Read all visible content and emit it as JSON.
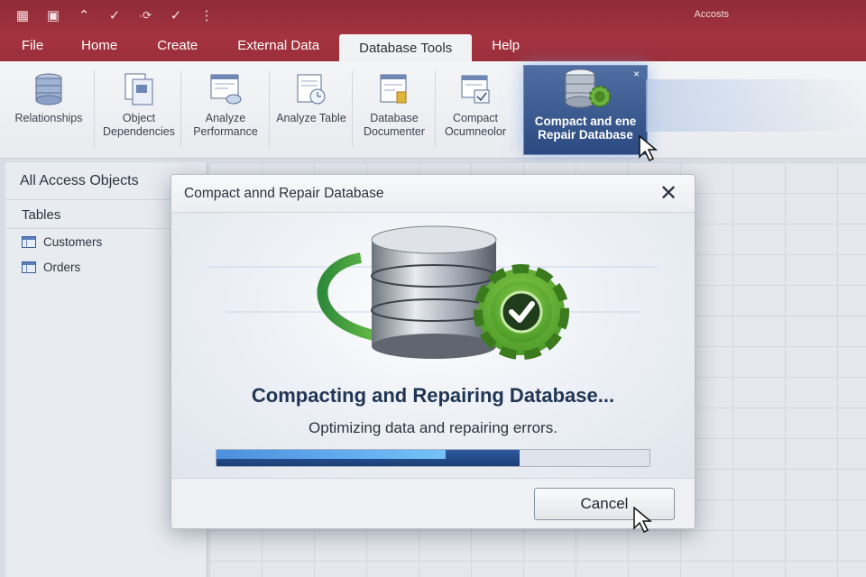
{
  "app": {
    "title": "Accosts"
  },
  "quick_access": [
    "table-icon",
    "image-icon",
    "undo-icon",
    "redo-icon",
    "refresh-icon",
    "check-icon",
    "more-icon"
  ],
  "tabs": [
    {
      "label": "File"
    },
    {
      "label": "Home"
    },
    {
      "label": "Create"
    },
    {
      "label": "External Data"
    },
    {
      "label": "Database Tools",
      "active": true
    },
    {
      "label": "Help"
    }
  ],
  "ribbon": {
    "relationships": "Relationships",
    "object_dependencies": "Object Dependencies",
    "analyze_performance": "Analyze Performance",
    "analyze_table": "Analyze Table",
    "database_documenter": "Database Documenter",
    "compact_ocumneolor": "Compact Ocumneolor",
    "compact_repair_line1": "Compact and ene",
    "compact_repair_line2": "Repair Database"
  },
  "nav": {
    "title": "All  Access Objects",
    "category": "Tables",
    "items": [
      {
        "label": "Customers"
      },
      {
        "label": "Orders"
      }
    ]
  },
  "dialog": {
    "title": "Compact  annd Repair Database",
    "heading": "Compacting and Repairing Database...",
    "subtitle": "Optimizing data and repairing errors.",
    "progress": 0.7,
    "progress_highlight": 0.53,
    "cancel_label": "Cancel"
  },
  "colors": {
    "title_bar": "#a5333f",
    "accent_blue": "#2c4a80",
    "check_green": "#6db33f"
  }
}
